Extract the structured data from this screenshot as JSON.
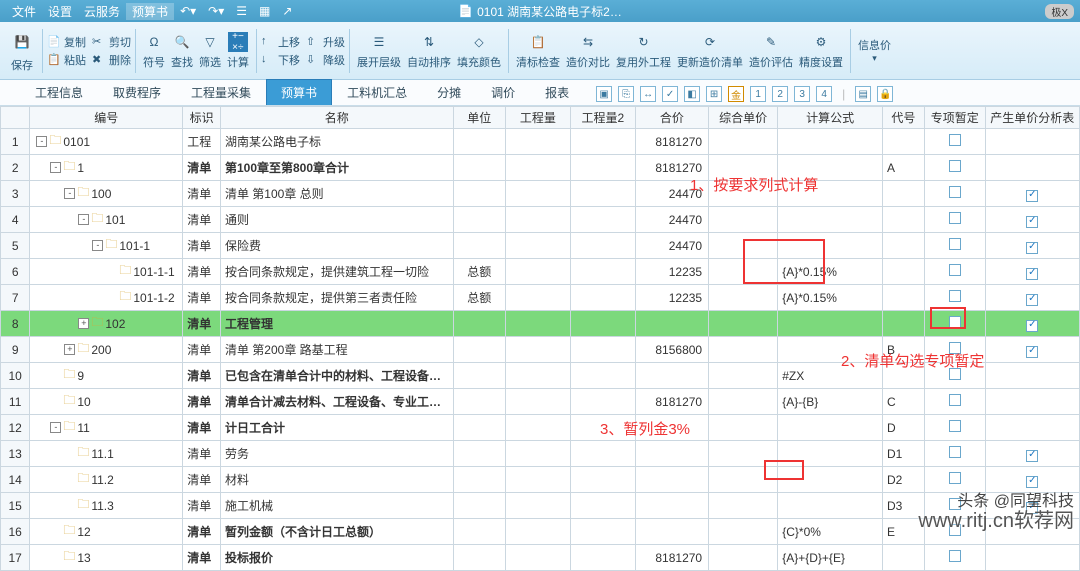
{
  "titlebar": {
    "menus": [
      "文件",
      "设置",
      "云服务",
      "预算书"
    ],
    "doc": "0101 湖南某公路电子标2…",
    "badge": "极X"
  },
  "ribbon": {
    "save": "保存",
    "copy": "复制",
    "cut": "剪切",
    "paste": "粘贴",
    "delete": "删除",
    "symbol": "符号",
    "find": "查找",
    "filter": "筛选",
    "calc": "计算",
    "up": "上移",
    "upgrade": "升级",
    "down": "下移",
    "downgrade": "降级",
    "expand": "展开层级",
    "autosort": "自动排序",
    "fillcolor": "填充颜色",
    "listcheck": "清标检查",
    "pricecmp": "造价对比",
    "reuse": "复用外工程",
    "updlist": "更新造价清单",
    "priceeval": "造价评估",
    "precision": "精度设置",
    "infoprice": "信息价"
  },
  "tabs": {
    "items": [
      "工程信息",
      "取费程序",
      "工程量采集",
      "预算书",
      "工料机汇总",
      "分摊",
      "调价",
      "报表"
    ],
    "active": 3,
    "tool_nums": [
      "1",
      "2",
      "3",
      "4"
    ]
  },
  "grid": {
    "headers": [
      "编号",
      "标识",
      "名称",
      "单位",
      "工程量",
      "工程量2",
      "合价",
      "综合单价",
      "计算公式",
      "代号",
      "专项暂定",
      "产生单价分析表"
    ],
    "rows": [
      {
        "n": 1,
        "indent": 0,
        "exp": "-",
        "code": "0101",
        "mark": "工程",
        "name": "湖南某公路电子标",
        "unit": "",
        "qty": "",
        "qty2": "",
        "total": "8181270",
        "price": "",
        "formula": "",
        "sym": "",
        "sp": false,
        "gen": false,
        "genShow": false
      },
      {
        "n": 2,
        "indent": 1,
        "exp": "-",
        "code": "1",
        "mark": "清单",
        "name": "第100章至第800章合计",
        "unit": "",
        "qty": "",
        "qty2": "",
        "total": "8181270",
        "price": "",
        "formula": "",
        "sym": "A",
        "sp": false,
        "gen": false,
        "genShow": false,
        "bold": true
      },
      {
        "n": 3,
        "indent": 2,
        "exp": "-",
        "code": "100",
        "mark": "清单",
        "name": "清单 第100章 总则",
        "unit": "",
        "qty": "",
        "qty2": "",
        "total": "24470",
        "price": "",
        "formula": "",
        "sym": "",
        "sp": false,
        "gen": true,
        "genShow": true
      },
      {
        "n": 4,
        "indent": 3,
        "exp": "-",
        "code": "101",
        "mark": "清单",
        "name": "通则",
        "unit": "",
        "qty": "",
        "qty2": "",
        "total": "24470",
        "price": "",
        "formula": "",
        "sym": "",
        "sp": false,
        "gen": true,
        "genShow": true
      },
      {
        "n": 5,
        "indent": 4,
        "exp": "-",
        "code": "101-1",
        "mark": "清单",
        "name": "保险费",
        "unit": "",
        "qty": "",
        "qty2": "",
        "total": "24470",
        "price": "",
        "formula": "",
        "sym": "",
        "sp": false,
        "gen": true,
        "genShow": true
      },
      {
        "n": 6,
        "indent": 5,
        "exp": "",
        "code": "101-1-1",
        "mark": "清单",
        "name": "按合同条款规定，提供建筑工程一切险",
        "unit": "总额",
        "qty": "",
        "qty2": "",
        "total": "12235",
        "price": "",
        "formula": "{A}*0.15%",
        "sym": "",
        "sp": false,
        "gen": true,
        "genShow": true
      },
      {
        "n": 7,
        "indent": 5,
        "exp": "",
        "code": "101-1-2",
        "mark": "清单",
        "name": "按合同条款规定，提供第三者责任险",
        "unit": "总额",
        "qty": "",
        "qty2": "",
        "total": "12235",
        "price": "",
        "formula": "{A}*0.15%",
        "sym": "",
        "sp": false,
        "gen": true,
        "genShow": true
      },
      {
        "n": 8,
        "indent": 3,
        "exp": "+",
        "code": "102",
        "mark": "清单",
        "name": "工程管理",
        "unit": "",
        "qty": "",
        "qty2": "",
        "total": "",
        "price": "",
        "formula": "",
        "sym": "",
        "sp": false,
        "gen": true,
        "genShow": true,
        "hl": true,
        "bold": true
      },
      {
        "n": 9,
        "indent": 2,
        "exp": "+",
        "code": "200",
        "mark": "清单",
        "name": "清单 第200章 路基工程",
        "unit": "",
        "qty": "",
        "qty2": "",
        "total": "8156800",
        "price": "",
        "formula": "",
        "sym": "B",
        "sp": false,
        "gen": true,
        "genShow": true
      },
      {
        "n": 10,
        "indent": 1,
        "exp": "",
        "code": "9",
        "mark": "清单",
        "name": "已包含在清单合计中的材料、工程设备…",
        "unit": "",
        "qty": "",
        "qty2": "",
        "total": "",
        "price": "",
        "formula": "#ZX",
        "sym": "",
        "sp": false,
        "gen": false,
        "genShow": false,
        "bold": true
      },
      {
        "n": 11,
        "indent": 1,
        "exp": "",
        "code": "10",
        "mark": "清单",
        "name": "清单合计减去材料、工程设备、专业工…",
        "unit": "",
        "qty": "",
        "qty2": "",
        "total": "8181270",
        "price": "",
        "formula": "{A}-{B}",
        "sym": "C",
        "sp": false,
        "gen": false,
        "genShow": false,
        "bold": true
      },
      {
        "n": 12,
        "indent": 1,
        "exp": "-",
        "code": "11",
        "mark": "清单",
        "name": "计日工合计",
        "unit": "",
        "qty": "",
        "qty2": "",
        "total": "",
        "price": "",
        "formula": "",
        "sym": "D",
        "sp": false,
        "gen": false,
        "genShow": false,
        "bold": true
      },
      {
        "n": 13,
        "indent": 2,
        "exp": "",
        "code": "11.1",
        "mark": "清单",
        "name": "劳务",
        "unit": "",
        "qty": "",
        "qty2": "",
        "total": "",
        "price": "",
        "formula": "",
        "sym": "D1",
        "sp": false,
        "gen": true,
        "genShow": true
      },
      {
        "n": 14,
        "indent": 2,
        "exp": "",
        "code": "11.2",
        "mark": "清单",
        "name": "材料",
        "unit": "",
        "qty": "",
        "qty2": "",
        "total": "",
        "price": "",
        "formula": "",
        "sym": "D2",
        "sp": false,
        "gen": true,
        "genShow": true
      },
      {
        "n": 15,
        "indent": 2,
        "exp": "",
        "code": "11.3",
        "mark": "清单",
        "name": "施工机械",
        "unit": "",
        "qty": "",
        "qty2": "",
        "total": "",
        "price": "",
        "formula": "",
        "sym": "D3",
        "sp": false,
        "gen": true,
        "genShow": true
      },
      {
        "n": 16,
        "indent": 1,
        "exp": "",
        "code": "12",
        "mark": "清单",
        "name": "暂列金额（不含计日工总额）",
        "unit": "",
        "qty": "",
        "qty2": "",
        "total": "",
        "price": "",
        "formula": "{C}*0%",
        "sym": "E",
        "sp": false,
        "gen": false,
        "genShow": false,
        "bold": true
      },
      {
        "n": 17,
        "indent": 1,
        "exp": "",
        "code": "13",
        "mark": "清单",
        "name": "投标报价",
        "unit": "",
        "qty": "",
        "qty2": "",
        "total": "8181270",
        "price": "",
        "formula": "{A}+{D}+{E}",
        "sym": "",
        "sp": false,
        "gen": false,
        "genShow": false,
        "bold": true
      }
    ]
  },
  "annotations": {
    "a1": "1、按要求列式计算",
    "a2": "2、清单勾选专项暂定",
    "a3": "3、暂列金3%"
  },
  "watermark": "www.ritj.cn软荐网",
  "watermark2": "头条 @同望科技"
}
